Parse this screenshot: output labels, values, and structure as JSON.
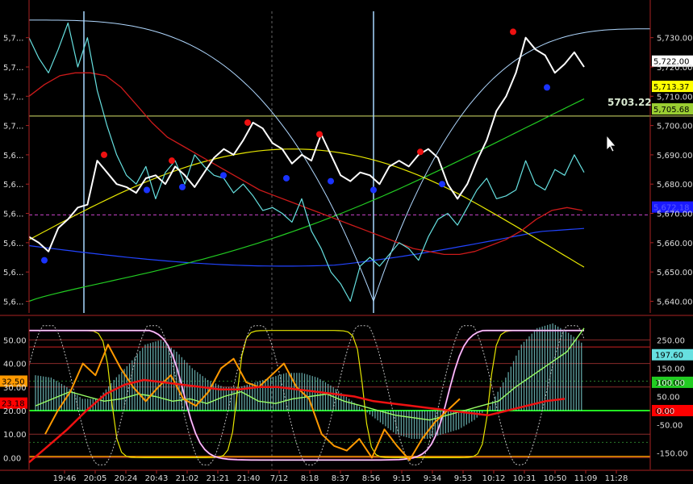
{
  "chart_data": [
    {
      "type": "line",
      "panel": "price",
      "y_right_ticks": [
        "5,730.00",
        "5,720.00",
        "5,710.00",
        "5,700.00",
        "5,690.00",
        "5,680.00",
        "5,670.00",
        "5,660.00",
        "5,650.00",
        "5,640.00"
      ],
      "y_right_values": [
        5730,
        5720,
        5710,
        5700,
        5690,
        5680,
        5670,
        5660,
        5650,
        5640
      ],
      "y_left_ticks": [
        "5,7...",
        "5,7...",
        "5,7...",
        "5,7...",
        "5,6...",
        "5,6...",
        "5,6...",
        "5,6...",
        "5,6...",
        "5,6..."
      ],
      "ylim": [
        5636,
        5739
      ],
      "price_labels": [
        {
          "text": "5,722.00",
          "value": 5722.0,
          "bg": "#ffffff",
          "fg": "#000000"
        },
        {
          "text": "5,713.37",
          "value": 5713.37,
          "bg": "#ffff00",
          "fg": "#000000"
        },
        {
          "text": "5,705.68",
          "value": 5705.68,
          "bg": "#9acd32",
          "fg": "#000000"
        },
        {
          "text": "5,672.18",
          "value": 5672.18,
          "bg": "#1a1aff",
          "fg": "#5a5aff"
        }
      ],
      "hline_label": {
        "text": "5703.22",
        "value": 5703.22
      },
      "dashed_level": 5669.5,
      "colors": {
        "price": "#ffffff",
        "cyan": "#66e0e0",
        "red": "#cc1a1a",
        "yellow": "#e6e600",
        "green": "#22cc22",
        "blue": "#2244ff",
        "arc": "#b0d8ff",
        "hline": "#d9e36b",
        "dash": "#cc44cc"
      },
      "series": [
        {
          "key": "price",
          "values": [
            5662,
            5660,
            5657,
            5665,
            5668,
            5672,
            5673,
            5688,
            5684,
            5680,
            5679,
            5677,
            5682,
            5683,
            5680,
            5686,
            5683,
            5679,
            5684,
            5689,
            5692,
            5690,
            5695,
            5701,
            5699,
            5694,
            5692,
            5687,
            5690,
            5688,
            5697,
            5690,
            5683,
            5681,
            5684,
            5683,
            5680,
            5686,
            5688,
            5686,
            5690,
            5692,
            5689,
            5680,
            5675,
            5680,
            5688,
            5695,
            5705,
            5710,
            5718,
            5730,
            5726,
            5724,
            5718,
            5721,
            5725,
            5720
          ]
        },
        {
          "key": "cyan",
          "values": [
            5730,
            5723,
            5718,
            5726,
            5735,
            5720,
            5730,
            5712,
            5700,
            5690,
            5683,
            5680,
            5686,
            5675,
            5684,
            5688,
            5680,
            5690,
            5686,
            5683,
            5682,
            5677,
            5680,
            5676,
            5671,
            5672,
            5670,
            5667,
            5675,
            5664,
            5658,
            5650,
            5646,
            5640,
            5652,
            5655,
            5652,
            5656,
            5660,
            5658,
            5654,
            5662,
            5668,
            5670,
            5666,
            5672,
            5678,
            5682,
            5675,
            5676,
            5678,
            5688,
            5680,
            5678,
            5685,
            5683,
            5690,
            5684
          ]
        },
        {
          "key": "red",
          "values": [
            5710,
            5714,
            5717,
            5718,
            5718,
            5717,
            5713,
            5707,
            5701,
            5696,
            5693,
            5690,
            5687,
            5684,
            5681,
            5678,
            5676,
            5674,
            5672,
            5670,
            5668,
            5666,
            5664,
            5662,
            5660,
            5658,
            5657,
            5656,
            5656,
            5657,
            5659,
            5661,
            5664,
            5668,
            5671,
            5672,
            5671
          ]
        }
      ],
      "swing_highs": [
        5690,
        5688,
        5701,
        5697,
        5691,
        5732
      ],
      "swing_lows": [
        5654,
        5678,
        5679,
        5683,
        5682,
        5681,
        5678,
        5680,
        5713
      ]
    },
    {
      "type": "line",
      "panel": "oscillator",
      "x_tick_labels": [
        "19:46",
        "20:05",
        "20:24",
        "20:43",
        "21:02",
        "21:21",
        "21:40",
        "7/12",
        "8:18",
        "8:37",
        "8:56",
        "9:15",
        "9:34",
        "9:53",
        "10:12",
        "10:31",
        "10:50",
        "11:09",
        "11:28"
      ],
      "y_left_ticks": [
        "50.00",
        "40.00",
        "30.00",
        "20.00",
        "10.00",
        "0.00"
      ],
      "y_left_values": [
        50,
        40,
        30,
        20,
        10,
        0
      ],
      "ylim": [
        -5,
        58
      ],
      "y_right_ticks": [
        "250.00",
        "150.00",
        "100.00",
        "50.00",
        "0.00",
        "-50.00",
        "-150.00"
      ],
      "y_right_values": [
        250,
        150,
        100,
        50,
        0,
        -50,
        -150
      ],
      "right_labels": [
        {
          "text": "197.60",
          "value": 197.6,
          "bg": "#66e0e0",
          "fg": "#000000"
        },
        {
          "text": "100.00",
          "value": 100,
          "bg": "#22cc22",
          "fg": "#000000"
        },
        {
          "text": "0.00",
          "value": 0,
          "bg": "#ff0000",
          "fg": "#000000"
        }
      ],
      "left_labels": [
        {
          "text": "32.50",
          "value": 32.5,
          "bg": "#ff9900",
          "fg": "#000000"
        },
        {
          "text": "23.18",
          "value": 23.18,
          "bg": "#ff0000",
          "fg": "#000000"
        }
      ],
      "series": [
        {
          "key": "histogram",
          "values": [
            35,
            34,
            30,
            25,
            25,
            33,
            40,
            48,
            50,
            45,
            38,
            33,
            30,
            30,
            32,
            34,
            36,
            36,
            34,
            30,
            25,
            20,
            15,
            10,
            8,
            8,
            10,
            12,
            16,
            22,
            34,
            48,
            55,
            57,
            53,
            48
          ]
        },
        {
          "key": "orange",
          "values": [
            10,
            20,
            28,
            40,
            35,
            48,
            38,
            30,
            24,
            30,
            35,
            25,
            22,
            28,
            38,
            42,
            32,
            30,
            35,
            40,
            30,
            25,
            10,
            5,
            3,
            8,
            0,
            12,
            5,
            -1,
            8,
            15,
            20,
            25
          ]
        },
        {
          "key": "green_osc",
          "values": [
            22,
            25,
            28,
            26,
            24,
            25,
            27,
            26,
            24,
            25,
            23,
            26,
            28,
            24,
            23,
            25,
            26,
            27,
            24,
            22,
            20,
            18,
            17,
            16,
            18,
            20,
            22,
            24,
            30,
            35,
            40,
            45,
            55
          ]
        },
        {
          "key": "red_osc",
          "values": [
            -2,
            5,
            12,
            20,
            27,
            31,
            33,
            32,
            31,
            30,
            29,
            29,
            30,
            30,
            29,
            28,
            27,
            26,
            24,
            23,
            22,
            21,
            20,
            19,
            18,
            20,
            22,
            24,
            25
          ]
        }
      ],
      "colors": {
        "histogram": "#7fd6d6",
        "orange": "#ff9900",
        "yellow": "#e6e600",
        "green_osc": "#99ff66",
        "red_osc": "#ee1111",
        "magenta": "#dd66dd",
        "white": "#ffffff",
        "grid": "#8a2a2a"
      }
    }
  ]
}
